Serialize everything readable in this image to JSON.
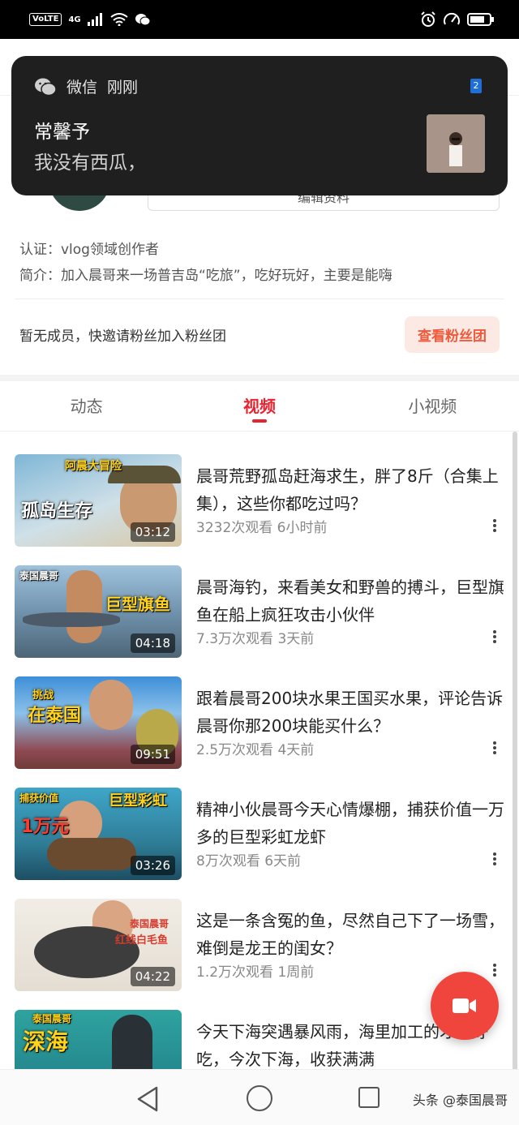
{
  "status_bar": {
    "volte": "VoLTE",
    "network": "4G",
    "icons": [
      "signal-icon",
      "wifi-icon",
      "wechat-icon",
      "alarm-icon",
      "speed-icon",
      "battery-icon"
    ]
  },
  "notification": {
    "app_name": "微信",
    "time": "刚刚",
    "sender": "常馨予",
    "message": "我没有西瓜，",
    "badge": "2"
  },
  "profile": {
    "edit_button": "编辑资料",
    "certification": "认证：vlog领域创作者",
    "intro": "简介：加入晨哥来一场普吉岛“吃旅”，吃好玩好，主要是能嗨"
  },
  "fans": {
    "text": "暂无成员，快邀请粉丝加入粉丝团",
    "button": "查看粉丝团"
  },
  "tabs": [
    {
      "label": "动态",
      "active": false
    },
    {
      "label": "视频",
      "active": true
    },
    {
      "label": "小视频",
      "active": false
    }
  ],
  "videos": [
    {
      "title": "晨哥荒野孤岛赶海求生，胖了8斤（合集上集），这些你都吃过吗？",
      "views": "3232次观看",
      "time": "6小时前",
      "duration": "03:12",
      "thumb_text": "孤岛生存"
    },
    {
      "title": "晨哥海钓，来看美女和野兽的搏斗，巨型旗鱼在船上疯狂攻击小伙伴",
      "views": "7.3万次观看",
      "time": "3天前",
      "duration": "04:18",
      "thumb_text": "巨型旗鱼"
    },
    {
      "title": "跟着晨哥200块水果王国买水果，评论告诉晨哥你那200块能买什么？",
      "views": "2.5万次观看",
      "time": "4天前",
      "duration": "09:51",
      "thumb_text": "在泰国"
    },
    {
      "title": "精神小伙晨哥今天心情爆棚，捕获价值一万多的巨型彩虹龙虾",
      "views": "8万次观看",
      "time": "6天前",
      "duration": "03:26",
      "thumb_text": "巨型彩虹"
    },
    {
      "title": "这是一条含冤的鱼，尽然自己下了一场雪，难倒是龙王的闺女？",
      "views": "1.2万次观看",
      "time": "1周前",
      "duration": "04:22",
      "thumb_text": "红线白毛鱼"
    },
    {
      "title": "今天下海突遇暴风雨，海里加工的才最好吃，今次下海，收获满满",
      "views": "",
      "time": "",
      "duration": "",
      "thumb_text": "深海"
    }
  ],
  "watermark": "头条 @泰国晨哥",
  "colors": {
    "accent": "#e8222e",
    "fab": "#f0453d",
    "fans_button_bg": "#fde9e3"
  }
}
